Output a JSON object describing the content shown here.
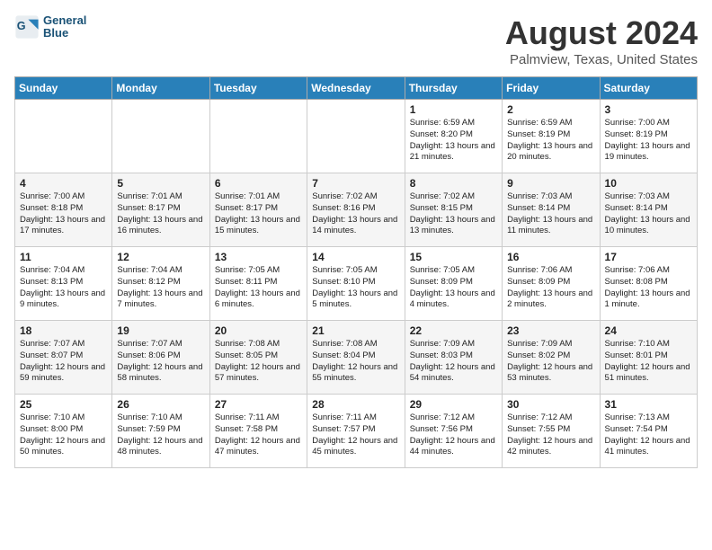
{
  "header": {
    "logo_line1": "General",
    "logo_line2": "Blue",
    "title": "August 2024",
    "location": "Palmview, Texas, United States"
  },
  "weekdays": [
    "Sunday",
    "Monday",
    "Tuesday",
    "Wednesday",
    "Thursday",
    "Friday",
    "Saturday"
  ],
  "weeks": [
    [
      {
        "day": "",
        "info": ""
      },
      {
        "day": "",
        "info": ""
      },
      {
        "day": "",
        "info": ""
      },
      {
        "day": "",
        "info": ""
      },
      {
        "day": "1",
        "info": "Sunrise: 6:59 AM\nSunset: 8:20 PM\nDaylight: 13 hours and 21 minutes."
      },
      {
        "day": "2",
        "info": "Sunrise: 6:59 AM\nSunset: 8:19 PM\nDaylight: 13 hours and 20 minutes."
      },
      {
        "day": "3",
        "info": "Sunrise: 7:00 AM\nSunset: 8:19 PM\nDaylight: 13 hours and 19 minutes."
      }
    ],
    [
      {
        "day": "4",
        "info": "Sunrise: 7:00 AM\nSunset: 8:18 PM\nDaylight: 13 hours and 17 minutes."
      },
      {
        "day": "5",
        "info": "Sunrise: 7:01 AM\nSunset: 8:17 PM\nDaylight: 13 hours and 16 minutes."
      },
      {
        "day": "6",
        "info": "Sunrise: 7:01 AM\nSunset: 8:17 PM\nDaylight: 13 hours and 15 minutes."
      },
      {
        "day": "7",
        "info": "Sunrise: 7:02 AM\nSunset: 8:16 PM\nDaylight: 13 hours and 14 minutes."
      },
      {
        "day": "8",
        "info": "Sunrise: 7:02 AM\nSunset: 8:15 PM\nDaylight: 13 hours and 13 minutes."
      },
      {
        "day": "9",
        "info": "Sunrise: 7:03 AM\nSunset: 8:14 PM\nDaylight: 13 hours and 11 minutes."
      },
      {
        "day": "10",
        "info": "Sunrise: 7:03 AM\nSunset: 8:14 PM\nDaylight: 13 hours and 10 minutes."
      }
    ],
    [
      {
        "day": "11",
        "info": "Sunrise: 7:04 AM\nSunset: 8:13 PM\nDaylight: 13 hours and 9 minutes."
      },
      {
        "day": "12",
        "info": "Sunrise: 7:04 AM\nSunset: 8:12 PM\nDaylight: 13 hours and 7 minutes."
      },
      {
        "day": "13",
        "info": "Sunrise: 7:05 AM\nSunset: 8:11 PM\nDaylight: 13 hours and 6 minutes."
      },
      {
        "day": "14",
        "info": "Sunrise: 7:05 AM\nSunset: 8:10 PM\nDaylight: 13 hours and 5 minutes."
      },
      {
        "day": "15",
        "info": "Sunrise: 7:05 AM\nSunset: 8:09 PM\nDaylight: 13 hours and 4 minutes."
      },
      {
        "day": "16",
        "info": "Sunrise: 7:06 AM\nSunset: 8:09 PM\nDaylight: 13 hours and 2 minutes."
      },
      {
        "day": "17",
        "info": "Sunrise: 7:06 AM\nSunset: 8:08 PM\nDaylight: 13 hours and 1 minute."
      }
    ],
    [
      {
        "day": "18",
        "info": "Sunrise: 7:07 AM\nSunset: 8:07 PM\nDaylight: 12 hours and 59 minutes."
      },
      {
        "day": "19",
        "info": "Sunrise: 7:07 AM\nSunset: 8:06 PM\nDaylight: 12 hours and 58 minutes."
      },
      {
        "day": "20",
        "info": "Sunrise: 7:08 AM\nSunset: 8:05 PM\nDaylight: 12 hours and 57 minutes."
      },
      {
        "day": "21",
        "info": "Sunrise: 7:08 AM\nSunset: 8:04 PM\nDaylight: 12 hours and 55 minutes."
      },
      {
        "day": "22",
        "info": "Sunrise: 7:09 AM\nSunset: 8:03 PM\nDaylight: 12 hours and 54 minutes."
      },
      {
        "day": "23",
        "info": "Sunrise: 7:09 AM\nSunset: 8:02 PM\nDaylight: 12 hours and 53 minutes."
      },
      {
        "day": "24",
        "info": "Sunrise: 7:10 AM\nSunset: 8:01 PM\nDaylight: 12 hours and 51 minutes."
      }
    ],
    [
      {
        "day": "25",
        "info": "Sunrise: 7:10 AM\nSunset: 8:00 PM\nDaylight: 12 hours and 50 minutes."
      },
      {
        "day": "26",
        "info": "Sunrise: 7:10 AM\nSunset: 7:59 PM\nDaylight: 12 hours and 48 minutes."
      },
      {
        "day": "27",
        "info": "Sunrise: 7:11 AM\nSunset: 7:58 PM\nDaylight: 12 hours and 47 minutes."
      },
      {
        "day": "28",
        "info": "Sunrise: 7:11 AM\nSunset: 7:57 PM\nDaylight: 12 hours and 45 minutes."
      },
      {
        "day": "29",
        "info": "Sunrise: 7:12 AM\nSunset: 7:56 PM\nDaylight: 12 hours and 44 minutes."
      },
      {
        "day": "30",
        "info": "Sunrise: 7:12 AM\nSunset: 7:55 PM\nDaylight: 12 hours and 42 minutes."
      },
      {
        "day": "31",
        "info": "Sunrise: 7:13 AM\nSunset: 7:54 PM\nDaylight: 12 hours and 41 minutes."
      }
    ]
  ]
}
